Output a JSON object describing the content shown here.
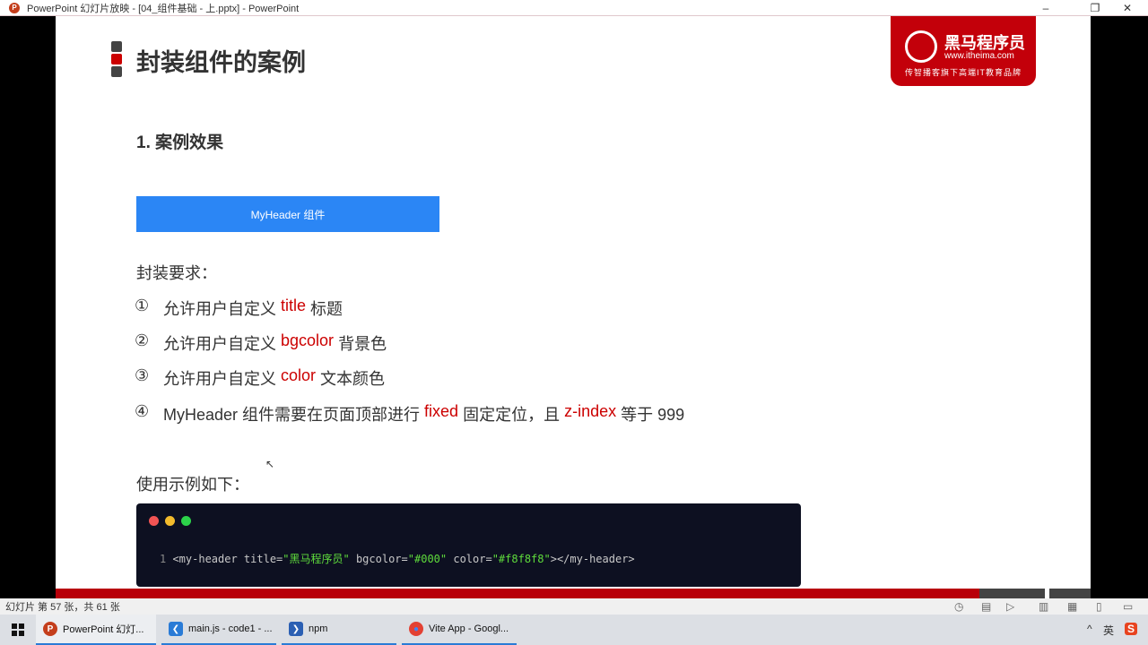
{
  "window": {
    "title": "PowerPoint 幻灯片放映 - [04_组件基础 - 上.pptx] - PowerPoint",
    "app_icon": "P",
    "minimize": "–",
    "restore": "❐",
    "close": "✕"
  },
  "slide": {
    "heading": "封装组件的案例",
    "logo": {
      "name": "黑马程序员",
      "url": "www.itheima.com",
      "slogan": "传智播客旗下高端IT教育品牌"
    },
    "subtitle": "1. 案例效果",
    "demo_header": "MyHeader 组件",
    "requirements_label": "封装要求：",
    "requirements": [
      {
        "num": "①",
        "pre": "允许用户自定义 ",
        "kw": "title",
        "post": " 标题"
      },
      {
        "num": "②",
        "pre": "允许用户自定义 ",
        "kw": "bgcolor",
        "post": " 背景色"
      },
      {
        "num": "③",
        "pre": "允许用户自定义 ",
        "kw": "color",
        "post": " 文本颜色"
      },
      {
        "num": "④",
        "pre": "MyHeader 组件需要在页面顶部进行 ",
        "kw": "fixed",
        "mid": " 固定定位，且 ",
        "kw2": "z-index",
        "post": " 等于 999"
      }
    ],
    "usage_label": "使用示例如下：",
    "code": {
      "line_no": "1",
      "p1": " <my-header title=",
      "s1": "\"黑马程序员\"",
      "p2": " bgcolor=",
      "s2": "\"#000\"",
      "p3": " color=",
      "s3": "\"#f8f8f8\"",
      "p4": "></my-header>"
    }
  },
  "status": {
    "slide_info": "幻灯片 第 57 张，共 61 张"
  },
  "taskbar": {
    "items": [
      {
        "label": "PowerPoint 幻灯...",
        "icon": "P"
      },
      {
        "label": "main.js - code1 - ...",
        "icon": "❮"
      },
      {
        "label": "npm",
        "icon": "❯"
      },
      {
        "label": "Vite App - Googl...",
        "icon": "●"
      }
    ],
    "tray": {
      "chevron": "^",
      "ime": "英",
      "sogou": "S"
    }
  },
  "colors": {
    "accent": "#c3000a",
    "blue": "#2b86f5",
    "code_bg": "#0d1021",
    "string": "#5fdc3c"
  }
}
